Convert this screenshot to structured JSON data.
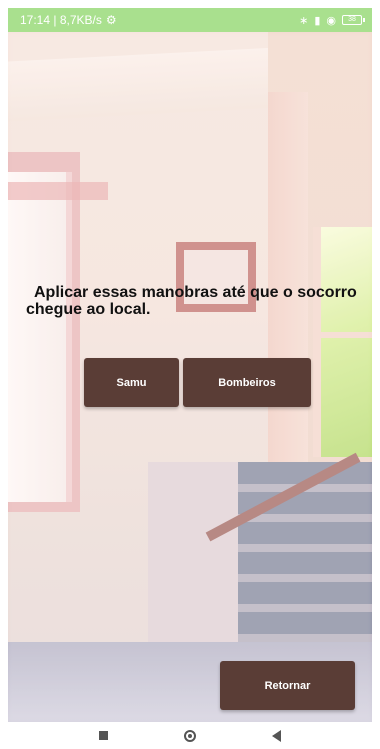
{
  "status_bar": {
    "time_speed": "17:14 | 8,7KB/s",
    "battery": "38"
  },
  "message": "Aplicar essas manobras até que o socorro chegue ao local.",
  "buttons": {
    "samu": "Samu",
    "bombeiros": "Bombeiros",
    "retornar": "Retornar"
  },
  "colors": {
    "status_bar_bg": "#a9e08e",
    "button_bg": "#5a3d36",
    "button_text": "#ffffff"
  },
  "icons": {
    "status_left": "settings-icon",
    "status_right": [
      "bluetooth-icon",
      "signal-icon",
      "wifi-icon",
      "battery-icon"
    ],
    "nav": [
      "recents-icon",
      "home-icon",
      "back-icon"
    ]
  }
}
